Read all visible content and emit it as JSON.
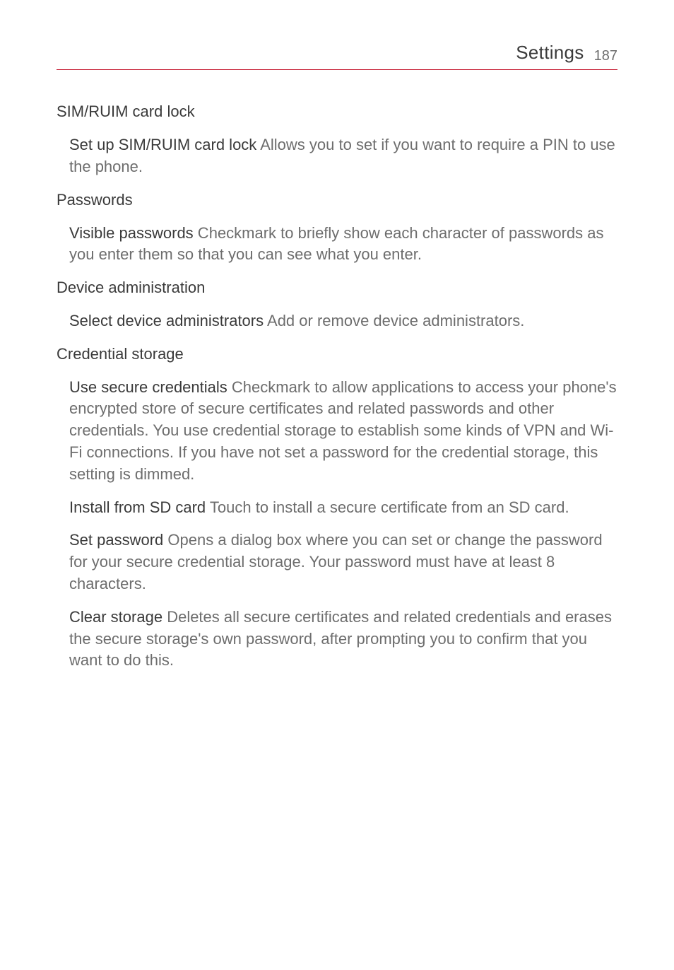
{
  "header": {
    "title": "Settings",
    "page_number": "187"
  },
  "sections": {
    "sim_lock": {
      "heading": "SIM/RUIM card lock",
      "item1_term": "Set up SIM/RUIM card lock",
      "item1_desc": " Allows you to set if you want to require a PIN to use the phone."
    },
    "passwords": {
      "heading": "Passwords",
      "item1_term": "Visible passwords",
      "item1_desc": " Checkmark to briefly show each character of passwords as you enter them so that you can see what you enter."
    },
    "device_admin": {
      "heading": "Device administration",
      "item1_term": "Select device administrators",
      "item1_desc": " Add or remove device administrators."
    },
    "credential_storage": {
      "heading": "Credential storage",
      "item1_term": "Use secure credentials",
      "item1_desc": " Checkmark to allow applications to access your phone's encrypted store of secure certificates and related passwords and other credentials. You use credential storage to establish some kinds of VPN and Wi-Fi connections. If you have not set a password for the credential storage, this setting is dimmed.",
      "item2_term": "Install from SD card",
      "item2_desc": " Touch to install a secure certificate from an SD card.",
      "item3_term": "Set password",
      "item3_desc": " Opens a dialog box where you can set or change the password for your secure credential storage. Your password must have at least 8 characters.",
      "item4_term": "Clear storage",
      "item4_desc": " Deletes all secure certificates and related credentials and erases the secure storage's own password, after prompting you to confirm that you want to do this."
    }
  }
}
